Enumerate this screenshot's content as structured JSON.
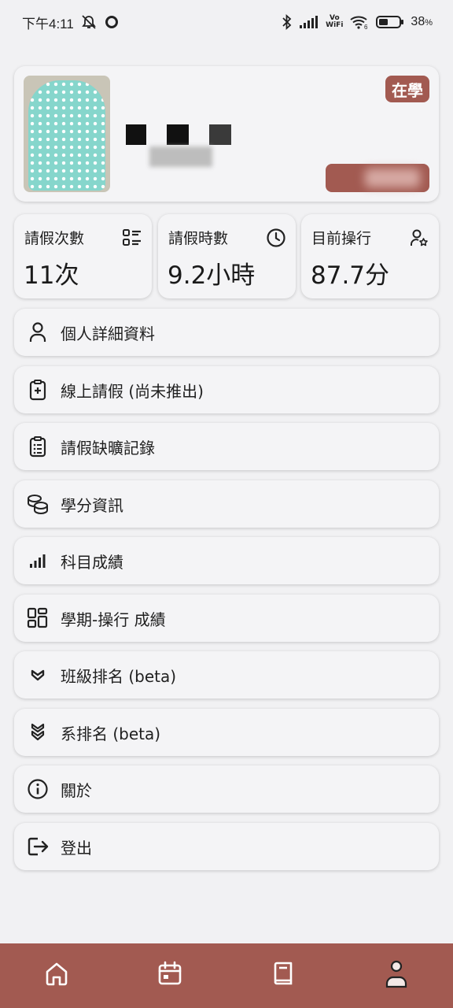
{
  "status_bar": {
    "time": "下午4:11",
    "vowifi_top": "Vo",
    "vowifi_bottom": "WiFi",
    "wifi_sub": "6",
    "battery_percent": "38",
    "battery_unit": "%"
  },
  "profile": {
    "status_badge": "在學"
  },
  "stats": [
    {
      "label": "請假次數",
      "value": "11次",
      "icon": "list-icon"
    },
    {
      "label": "請假時數",
      "value": "9.2小時",
      "icon": "clock-icon"
    },
    {
      "label": "目前操行",
      "value": "87.7分",
      "icon": "user-star-icon"
    }
  ],
  "menu": [
    {
      "label": "個人詳細資料",
      "icon": "person-icon"
    },
    {
      "label": "線上請假 (尚未推出)",
      "icon": "clipboard-plus-icon"
    },
    {
      "label": "請假缺曠記錄",
      "icon": "clipboard-list-icon"
    },
    {
      "label": "學分資訊",
      "icon": "coins-icon"
    },
    {
      "label": "科目成績",
      "icon": "signal-bars-icon"
    },
    {
      "label": "學期-操行 成績",
      "icon": "grid-icon"
    },
    {
      "label": "班級排名 (beta)",
      "icon": "chevron-badge-icon"
    },
    {
      "label": "系排名 (beta)",
      "icon": "double-chevron-icon"
    },
    {
      "label": "關於",
      "icon": "info-icon"
    },
    {
      "label": "登出",
      "icon": "logout-icon"
    }
  ],
  "bottom_nav": [
    "home-icon",
    "calendar-icon",
    "book-icon",
    "profile-icon"
  ],
  "colors": {
    "accent": "#a25a51",
    "background": "#f1f1f3",
    "card": "#f4f4f6"
  }
}
